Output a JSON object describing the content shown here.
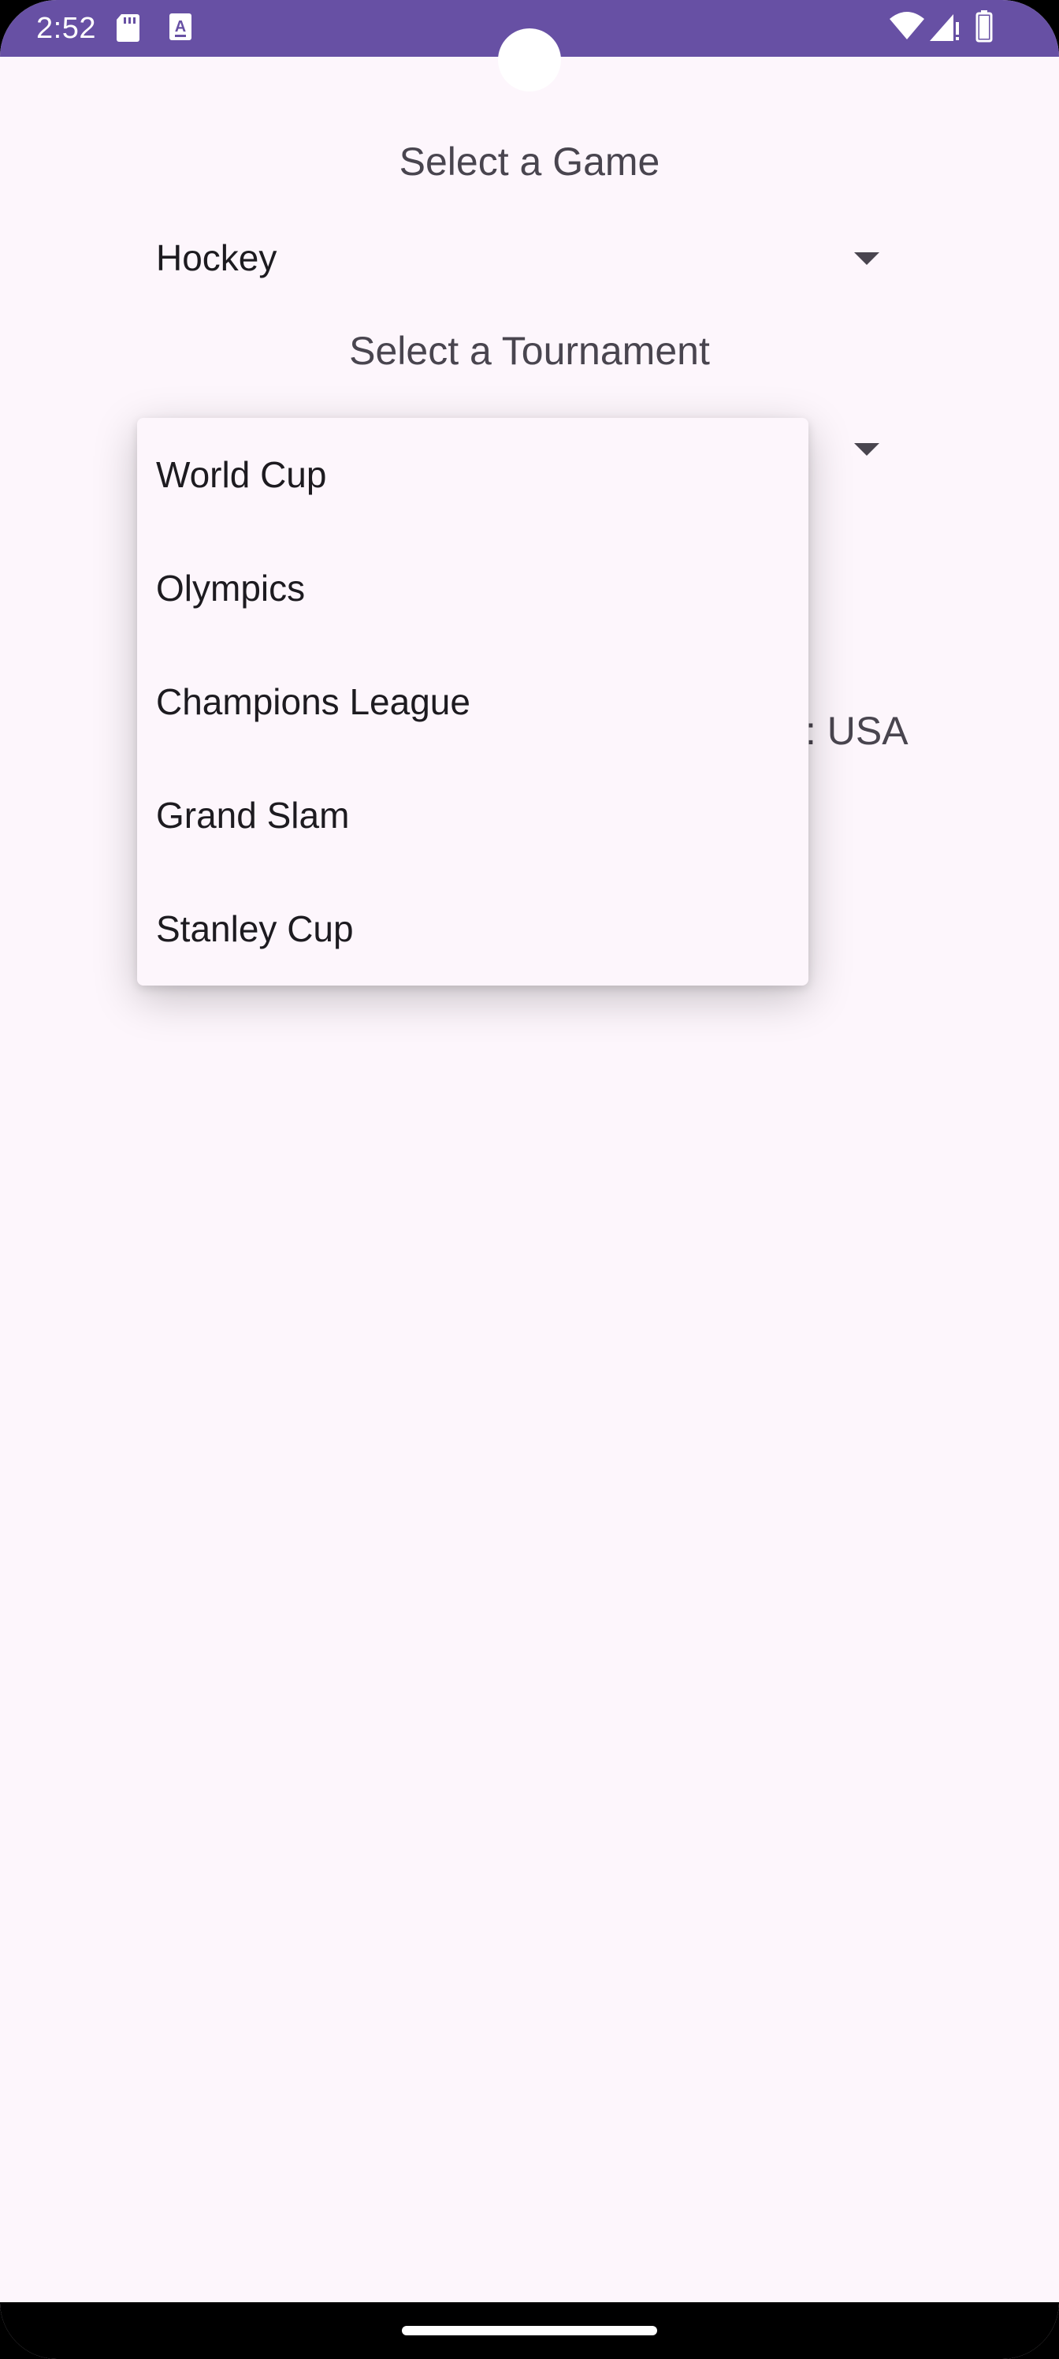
{
  "status_bar": {
    "time": "2:52",
    "icons": [
      "sd-card-icon",
      "keyboard-a-icon",
      "wifi-icon",
      "signal-icon",
      "battery-icon"
    ],
    "background": "#6750A4"
  },
  "game_section": {
    "label": "Select a Game",
    "selected": "Hockey"
  },
  "tournament_section": {
    "label": "Select a Tournament",
    "options": [
      "World Cup",
      "Olympics",
      "Champions League",
      "Grand Slam",
      "Stanley Cup"
    ]
  },
  "partial_text": ": USA",
  "colors": {
    "background": "#FDF6FC",
    "accent": "#6750A4",
    "text_primary": "#1D1B20",
    "text_secondary": "#49454F"
  }
}
